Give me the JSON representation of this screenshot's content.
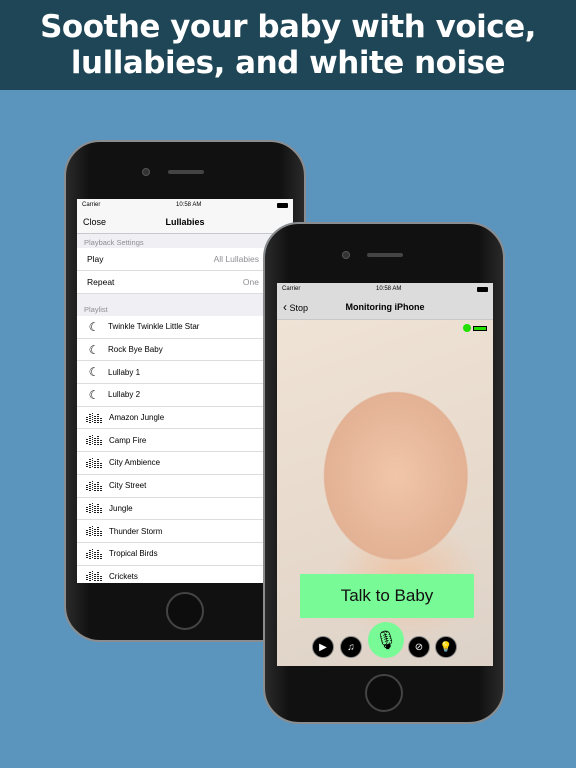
{
  "banner": {
    "line1": "Soothe your baby with voice,",
    "line2": "lullabies, and white noise"
  },
  "left_phone": {
    "status": {
      "carrier": "Carrier",
      "time": "10:58 AM"
    },
    "nav": {
      "close": "Close",
      "title": "Lullabies"
    },
    "playback_header": "Playback Settings",
    "settings": [
      {
        "label": "Play",
        "value": "All Lullabies"
      },
      {
        "label": "Repeat",
        "value": "One"
      }
    ],
    "playlist_header": "Playlist",
    "playlist": [
      {
        "name": "Twinkle Twinkle Little Star",
        "icon": "moon-icon"
      },
      {
        "name": "Rock Bye Baby",
        "icon": "moon-icon"
      },
      {
        "name": "Lullaby 1",
        "icon": "moon-icon"
      },
      {
        "name": "Lullaby 2",
        "icon": "moon-icon"
      },
      {
        "name": "Amazon Jungle",
        "icon": "equalizer-icon"
      },
      {
        "name": "Camp Fire",
        "icon": "equalizer-icon"
      },
      {
        "name": "City Ambience",
        "icon": "equalizer-icon"
      },
      {
        "name": "City Street",
        "icon": "equalizer-icon"
      },
      {
        "name": "Jungle",
        "icon": "equalizer-icon"
      },
      {
        "name": "Thunder Storm",
        "icon": "equalizer-icon"
      },
      {
        "name": "Tropical Birds",
        "icon": "equalizer-icon"
      },
      {
        "name": "Crickets",
        "icon": "equalizer-icon"
      }
    ]
  },
  "right_phone": {
    "status": {
      "carrier": "Carrier",
      "time": "10:58 AM"
    },
    "nav": {
      "back": "Stop",
      "title": "Monitoring iPhone"
    },
    "talk_button": "Talk to Baby",
    "colors": {
      "talk": "#78fa96",
      "indicator": "#22e000"
    }
  }
}
